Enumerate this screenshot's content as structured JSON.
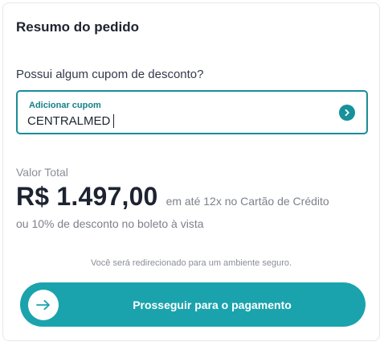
{
  "summary": {
    "title": "Resumo do pedido"
  },
  "coupon": {
    "question": "Possui algum cupom de desconto?",
    "label": "Adicionar cupom",
    "value": "CENTRALMED",
    "apply_icon": "chevron-right-icon"
  },
  "total": {
    "label": "Valor Total",
    "value": "R$ 1.497,00",
    "installments": "em até 12x no Cartão de Crédito",
    "boleto": "ou 10% de desconto no boleto à vista"
  },
  "secure_note": "Você será redirecionado para um ambiente seguro.",
  "proceed": {
    "label": "Prosseguir para o pagamento",
    "icon": "arrow-right-icon"
  },
  "colors": {
    "accent": "#1aa3ad",
    "border_active": "#1a8d96",
    "label_teal": "#14808a"
  }
}
